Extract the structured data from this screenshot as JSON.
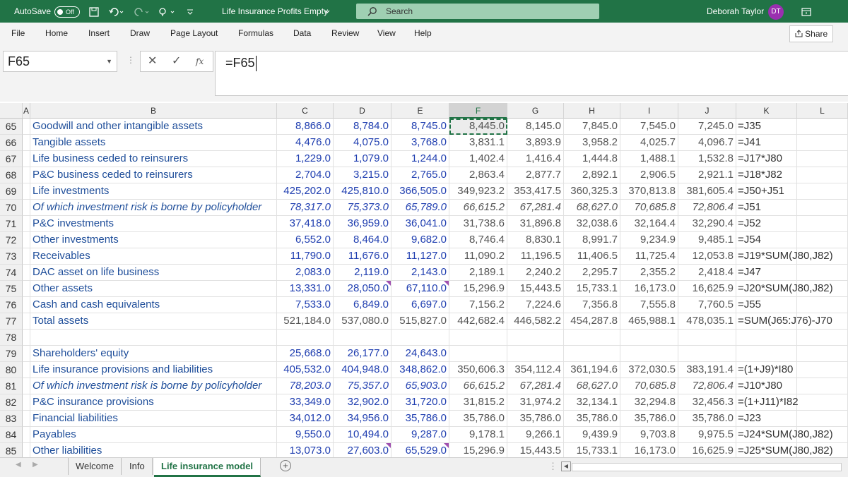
{
  "titlebar": {
    "autosave_label": "AutoSave",
    "autosave_state": "Off",
    "file_title": "Life Insurance Profits Empty",
    "search_label": "Search",
    "user_name": "Deborah Taylor",
    "user_initials": "DT",
    "accent": "#217346",
    "avatar_color": "#9a2fb0"
  },
  "ribbon_tabs": [
    "File",
    "Home",
    "Insert",
    "Draw",
    "Page Layout",
    "Formulas",
    "Data",
    "Review",
    "View",
    "Help"
  ],
  "share_label": "Share",
  "formula_bar": {
    "name_box": "F65",
    "cancel_icon": "✕",
    "enter_icon": "✓",
    "fx_label": "fx",
    "formula": "=F65"
  },
  "columns": [
    "A",
    "B",
    "C",
    "D",
    "E",
    "F",
    "G",
    "H",
    "I",
    "J",
    "K",
    "L"
  ],
  "rows": [
    {
      "n": "65",
      "label": "Goodwill and other intangible assets",
      "italic": false,
      "c": "8,866.0",
      "d": "8,784.0",
      "e": "8,745.0",
      "f": "8,445.0",
      "g": "8,145.0",
      "h": "7,845.0",
      "i": "7,545.0",
      "j": "7,245.0",
      "k": "=J35"
    },
    {
      "n": "66",
      "label": "Tangible assets",
      "italic": false,
      "c": "4,476.0",
      "d": "4,075.0",
      "e": "3,768.0",
      "f": "3,831.1",
      "g": "3,893.9",
      "h": "3,958.2",
      "i": "4,025.7",
      "j": "4,096.7",
      "k": "=J41"
    },
    {
      "n": "67",
      "label": "Life business ceded to reinsurers",
      "italic": false,
      "c": "1,229.0",
      "d": "1,079.0",
      "e": "1,244.0",
      "f": "1,402.4",
      "g": "1,416.4",
      "h": "1,444.8",
      "i": "1,488.1",
      "j": "1,532.8",
      "k": "=J17*J80"
    },
    {
      "n": "68",
      "label": "P&C business ceded to reinsurers",
      "italic": false,
      "c": "2,704.0",
      "d": "3,215.0",
      "e": "2,765.0",
      "f": "2,863.4",
      "g": "2,877.7",
      "h": "2,892.1",
      "i": "2,906.5",
      "j": "2,921.1",
      "k": "=J18*J82"
    },
    {
      "n": "69",
      "label": "Life investments",
      "italic": false,
      "c": "425,202.0",
      "d": "425,810.0",
      "e": "366,505.0",
      "f": "349,923.2",
      "g": "353,417.5",
      "h": "360,325.3",
      "i": "370,813.8",
      "j": "381,605.4",
      "k": "=J50+J51"
    },
    {
      "n": "70",
      "label": "Of which investment risk is borne by policyholder",
      "italic": true,
      "c": "78,317.0",
      "d": "75,373.0",
      "e": "65,789.0",
      "f": "66,615.2",
      "g": "67,281.4",
      "h": "68,627.0",
      "i": "70,685.8",
      "j": "72,806.4",
      "k": "=J51"
    },
    {
      "n": "71",
      "label": "P&C investments",
      "italic": false,
      "c": "37,418.0",
      "d": "36,959.0",
      "e": "36,041.0",
      "f": "31,738.6",
      "g": "31,896.8",
      "h": "32,038.6",
      "i": "32,164.4",
      "j": "32,290.4",
      "k": "=J52"
    },
    {
      "n": "72",
      "label": "Other investments",
      "italic": false,
      "c": "6,552.0",
      "d": "8,464.0",
      "e": "9,682.0",
      "f": "8,746.4",
      "g": "8,830.1",
      "h": "8,991.7",
      "i": "9,234.9",
      "j": "9,485.1",
      "k": "=J54"
    },
    {
      "n": "73",
      "label": "Receivables",
      "italic": false,
      "c": "11,790.0",
      "d": "11,676.0",
      "e": "11,127.0",
      "f": "11,090.2",
      "g": "11,196.5",
      "h": "11,406.5",
      "i": "11,725.4",
      "j": "12,053.8",
      "k": "=J19*SUM(J80,J82)"
    },
    {
      "n": "74",
      "label": "DAC asset on life business",
      "italic": false,
      "c": "2,083.0",
      "d": "2,119.0",
      "e": "2,143.0",
      "f": "2,189.1",
      "g": "2,240.2",
      "h": "2,295.7",
      "i": "2,355.2",
      "j": "2,418.4",
      "k": "=J47"
    },
    {
      "n": "75",
      "label": "Other assets",
      "italic": false,
      "c": "13,331.0",
      "d": "28,050.0",
      "e": "67,110.0",
      "f": "15,296.9",
      "g": "15,443.5",
      "h": "15,733.1",
      "i": "16,173.0",
      "j": "16,625.9",
      "k": "=J20*SUM(J80,J82)",
      "tri": [
        "d",
        "e"
      ]
    },
    {
      "n": "76",
      "label": "Cash and cash equivalents",
      "italic": false,
      "c": "7,533.0",
      "d": "6,849.0",
      "e": "6,697.0",
      "f": "7,156.2",
      "g": "7,224.6",
      "h": "7,356.8",
      "i": "7,555.8",
      "j": "7,760.5",
      "k": "=J55"
    },
    {
      "n": "77",
      "label": "Total assets",
      "italic": false,
      "total": true,
      "c": "521,184.0",
      "d": "537,080.0",
      "e": "515,827.0",
      "f": "442,682.4",
      "g": "446,582.2",
      "h": "454,287.8",
      "i": "465,988.1",
      "j": "478,035.1",
      "k": "=SUM(J65:J76)-J70"
    },
    {
      "n": "78",
      "label": "",
      "italic": false,
      "c": "",
      "d": "",
      "e": "",
      "f": "",
      "g": "",
      "h": "",
      "i": "",
      "j": "",
      "k": ""
    },
    {
      "n": "79",
      "label": "Shareholders' equity",
      "italic": false,
      "c": "25,668.0",
      "d": "26,177.0",
      "e": "24,643.0",
      "f": "",
      "g": "",
      "h": "",
      "i": "",
      "j": "",
      "k": ""
    },
    {
      "n": "80",
      "label": "Life insurance provisions and liabilities",
      "italic": false,
      "c": "405,532.0",
      "d": "404,948.0",
      "e": "348,862.0",
      "f": "350,606.3",
      "g": "354,112.4",
      "h": "361,194.6",
      "i": "372,030.5",
      "j": "383,191.4",
      "k": "=(1+J9)*I80"
    },
    {
      "n": "81",
      "label": "Of which investment risk is borne by policyholder",
      "italic": true,
      "c": "78,203.0",
      "d": "75,357.0",
      "e": "65,903.0",
      "f": "66,615.2",
      "g": "67,281.4",
      "h": "68,627.0",
      "i": "70,685.8",
      "j": "72,806.4",
      "k": "=J10*J80"
    },
    {
      "n": "82",
      "label": "P&C insurance provisions",
      "italic": false,
      "c": "33,349.0",
      "d": "32,902.0",
      "e": "31,720.0",
      "f": "31,815.2",
      "g": "31,974.2",
      "h": "32,134.1",
      "i": "32,294.8",
      "j": "32,456.3",
      "k": "=(1+J11)*I82"
    },
    {
      "n": "83",
      "label": "Financial liabilities",
      "italic": false,
      "c": "34,012.0",
      "d": "34,956.0",
      "e": "35,786.0",
      "f": "35,786.0",
      "g": "35,786.0",
      "h": "35,786.0",
      "i": "35,786.0",
      "j": "35,786.0",
      "k": "=J23"
    },
    {
      "n": "84",
      "label": "Payables",
      "italic": false,
      "c": "9,550.0",
      "d": "10,494.0",
      "e": "9,287.0",
      "f": "9,178.1",
      "g": "9,266.1",
      "h": "9,439.9",
      "i": "9,703.8",
      "j": "9,975.5",
      "k": "=J24*SUM(J80,J82)"
    },
    {
      "n": "85",
      "label": "Other liabilities",
      "italic": false,
      "c": "13,073.0",
      "d": "27,603.0",
      "e": "65,529.0",
      "f": "15,296.9",
      "g": "15,443.5",
      "h": "15,733.1",
      "i": "16,173.0",
      "j": "16,625.9",
      "k": "=J25*SUM(J80,J82)",
      "tri": [
        "d",
        "e"
      ]
    }
  ],
  "sheet_tabs": [
    {
      "label": "Welcome",
      "active": false
    },
    {
      "label": "Info",
      "active": false
    },
    {
      "label": "Life insurance model",
      "active": true
    }
  ],
  "add_sheet_icon": "+"
}
